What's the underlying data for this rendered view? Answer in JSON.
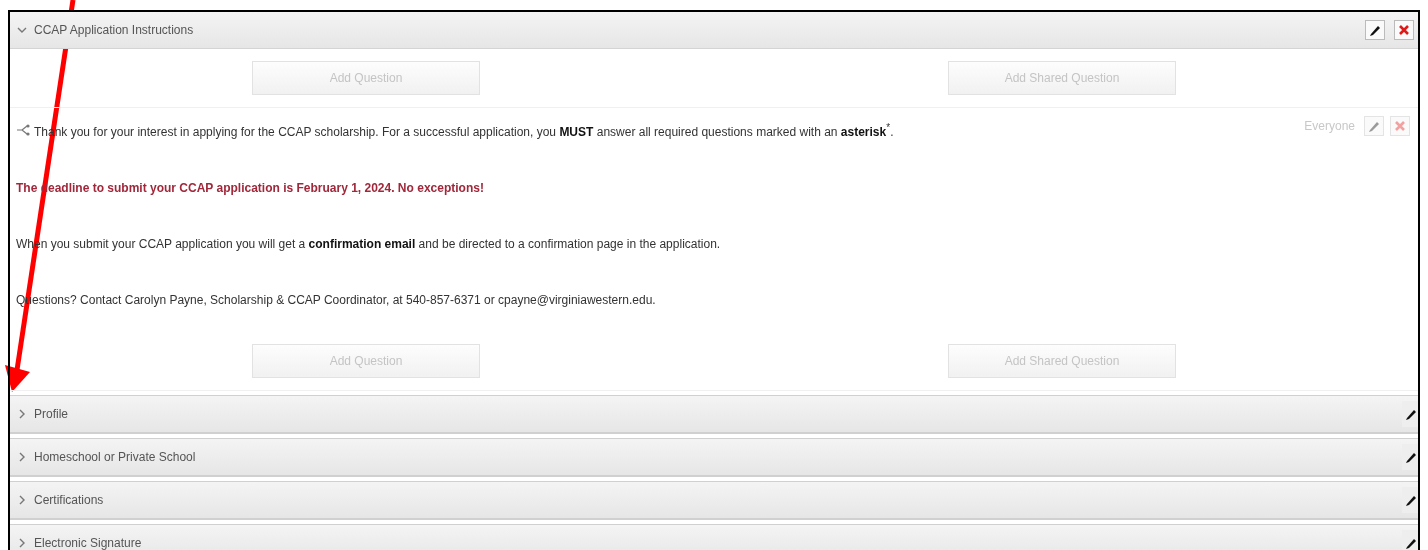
{
  "sections": [
    {
      "title": "CCAP Application Instructions",
      "expanded": true,
      "buttons_top": [
        {
          "label": "Add Question",
          "disabled": true
        },
        {
          "label": "Add Shared Question",
          "disabled": true
        }
      ],
      "visibility": "Everyone",
      "paragraphs": [
        {
          "kind": "intro",
          "text": "Thank you for your interest in applying for the CCAP scholarship. For a successful application, you **MUST** answer all required questions marked with an **asterisk**$^{*}$."
        },
        {
          "kind": "alert",
          "text": "The deadline to submit your CCAP application is February 1, 2024. No exceptions!"
        },
        {
          "kind": "normal",
          "text": "When you submit your CCAP application you will get a **confirmation email** and be directed to a confirmation page in the application."
        },
        {
          "kind": "normal",
          "text": "Questions? Contact Carolyn Payne, Scholarship & CCAP Coordinator, at 540-857-6371 or cpayne@virginiawestern.edu."
        }
      ],
      "buttons_bottom": [
        {
          "label": "Add Question",
          "disabled": true
        },
        {
          "label": "Add Shared Question",
          "disabled": true
        }
      ]
    },
    {
      "title": "Profile",
      "expanded": false
    },
    {
      "title": "Homeschool or Private School",
      "expanded": false
    },
    {
      "title": "Certifications",
      "expanded": false
    },
    {
      "title": "Electronic Signature",
      "expanded": false
    }
  ]
}
